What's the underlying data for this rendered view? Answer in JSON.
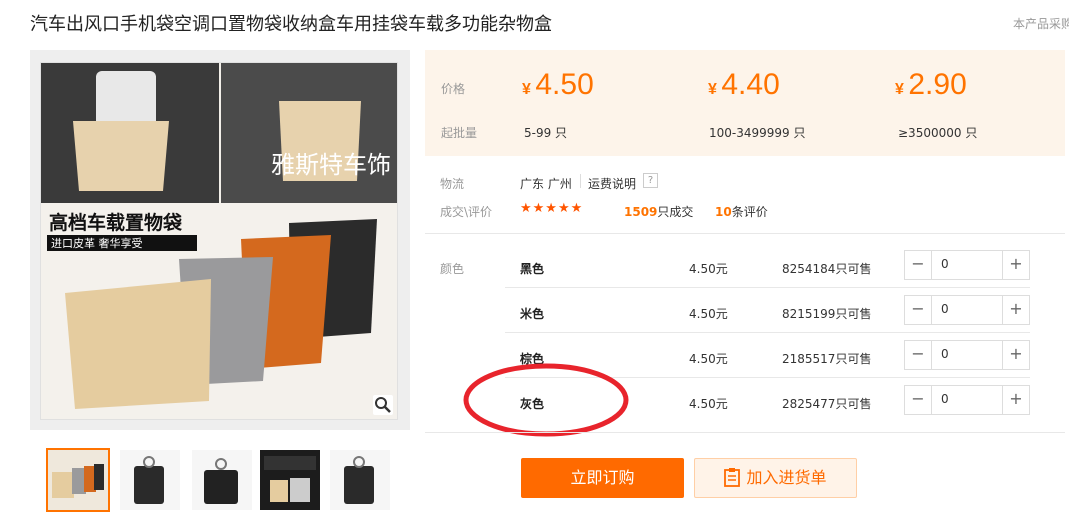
{
  "product": {
    "title": "汽车出风口手机袋空调口置物袋收纳盒车用挂袋车载多功能杂物盒",
    "side_note": "本产品采购"
  },
  "gallery": {
    "watermark": "雅斯特车饰",
    "banner_title": "高档车载置物袋",
    "banner_sub": "进口皮革  奢华享受",
    "thumb_count": 5
  },
  "pricing": {
    "price_label": "价格",
    "moq_label": "起批量",
    "currency": "¥",
    "tiers": [
      {
        "price": "4.50",
        "range": "5-99 只"
      },
      {
        "price": "4.40",
        "range": "100-3499999 只"
      },
      {
        "price": "2.90",
        "range": "≥3500000 只"
      }
    ]
  },
  "logistics": {
    "label": "物流",
    "location": "广东 广州",
    "shipping_link": "运费说明",
    "help_icon": "?"
  },
  "reviews": {
    "label": "成交\\评价",
    "stars": "★★★★★",
    "sold_count": "1509",
    "sold_suffix": "只成交",
    "review_count": "10",
    "review_suffix": "条评价"
  },
  "sku": {
    "label": "颜色",
    "rows": [
      {
        "name": "黑色",
        "price": "4.50元",
        "stock": "8254184只可售",
        "qty": "0"
      },
      {
        "name": "米色",
        "price": "4.50元",
        "stock": "8215199只可售",
        "qty": "0"
      },
      {
        "name": "棕色",
        "price": "4.50元",
        "stock": "2185517只可售",
        "qty": "0"
      },
      {
        "name": "灰色",
        "price": "4.50元",
        "stock": "2825477只可售",
        "qty": "0"
      }
    ]
  },
  "actions": {
    "order_label": "立即订购",
    "cart_label": "加入进货单"
  },
  "colors": {
    "accent": "#ff6a00",
    "price_orange": "#ff7300",
    "star": "#ff5500",
    "panel_bg": "#fdf4ea",
    "annotation_circle": "#e8242c"
  }
}
